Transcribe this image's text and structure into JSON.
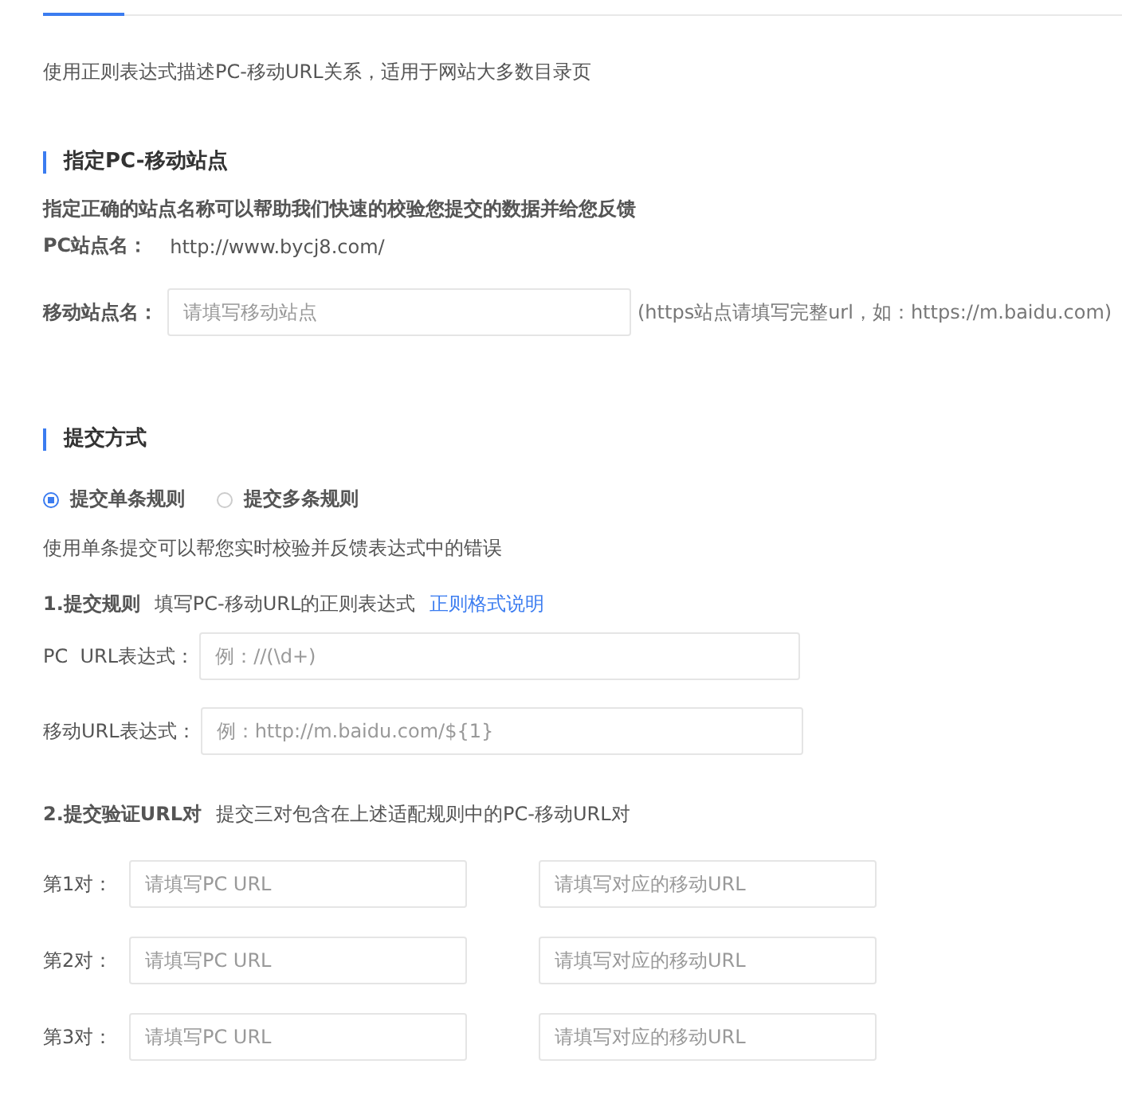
{
  "intro": "使用正则表达式描述PC-移动URL关系，适用于网站大多数目录页",
  "site_section": {
    "title": "指定PC-移动站点",
    "note": "指定正确的站点名称可以帮助我们快速的校验您提交的数据并给您反馈",
    "pc_label": "PC站点名：",
    "pc_value": "http://www.bycj8.com/",
    "mobile_label": "移动站点名：",
    "mobile_placeholder": "请填写移动站点",
    "mobile_hint": "(https站点请填写完整url，如：https://m.baidu.com)"
  },
  "submit_section": {
    "title": "提交方式",
    "modes": [
      {
        "label": "提交单条规则",
        "selected": true
      },
      {
        "label": "提交多条规则",
        "selected": false
      }
    ],
    "mode_note": "使用单条提交可以帮您实时校验并反馈表达式中的错误",
    "rule_title": "1.提交规则",
    "rule_desc": "填写PC-移动URL的正则表达式",
    "rule_link": "正则格式说明",
    "rule_fields": [
      {
        "label": "PC  URL表达式：",
        "placeholder": "例：//(\\d+)"
      },
      {
        "label": "移动URL表达式：",
        "placeholder": "例：http://m.baidu.com/${1}"
      }
    ],
    "pairs_title": "2.提交验证URL对",
    "pairs_desc": "提交三对包含在上述适配规则中的PC-移动URL对",
    "pairs": [
      {
        "label": "第1对：",
        "pc_placeholder": "请填写PC URL",
        "mobile_placeholder": "请填写对应的移动URL"
      },
      {
        "label": "第2对：",
        "pc_placeholder": "请填写PC URL",
        "mobile_placeholder": "请填写对应的移动URL"
      },
      {
        "label": "第3对：",
        "pc_placeholder": "请填写PC URL",
        "mobile_placeholder": "请填写对应的移动URL"
      }
    ]
  }
}
